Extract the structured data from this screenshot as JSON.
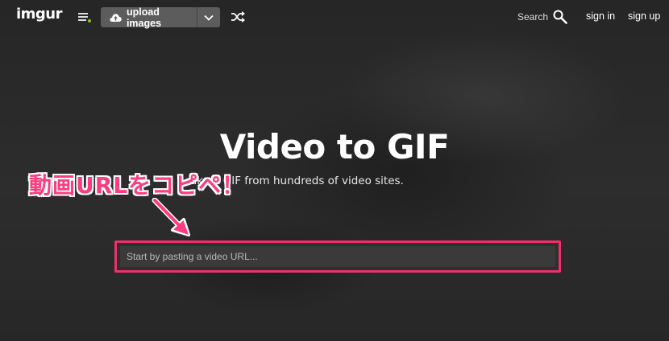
{
  "header": {
    "logo": "imgur",
    "upload_label": "upload images",
    "search_label": "Search",
    "sign_in": "sign in",
    "sign_up": "sign up",
    "icons": [
      "menu-icon",
      "cloud-upload-icon",
      "chevron-down-icon",
      "shuffle-icon",
      "search-icon"
    ]
  },
  "hero": {
    "title": "Video to GIF",
    "subtitle": "ake a GIF from hundreds of video sites."
  },
  "url_input": {
    "placeholder": "Start by pasting a video URL...",
    "value": ""
  },
  "annotation": {
    "text": "動画URLをコピペ！",
    "color": "#ff3d7f"
  },
  "colors": {
    "background": "#2a2a2a",
    "upload_button": "#5c5c5c",
    "highlight_border": "#f0306a",
    "menu_dot": "#85bf25"
  }
}
